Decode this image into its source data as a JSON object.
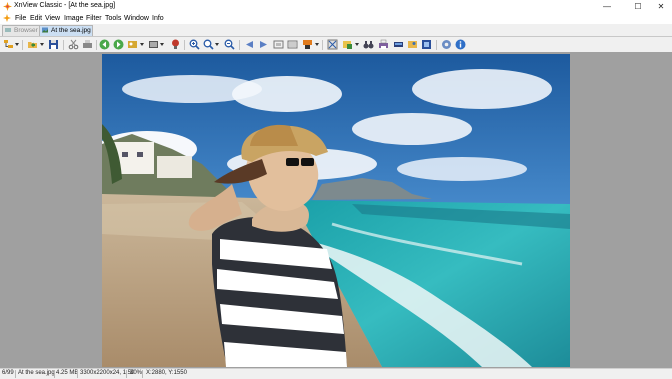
{
  "window": {
    "title": "XnView Classic - [At the sea.jpg]",
    "minimize_glyph": "—",
    "maximize_glyph": "☐",
    "close_glyph": "✕"
  },
  "menu": {
    "items": [
      "File",
      "Edit",
      "View",
      "Image",
      "Filter",
      "Tools",
      "Window",
      "Info"
    ]
  },
  "tabs": [
    {
      "label": "Browser",
      "active": false
    },
    {
      "label": "At the sea.jpg",
      "active": true
    }
  ],
  "toolbar": {
    "icons": [
      "browser-tree-icon",
      "open-folder-icon",
      "save-icon",
      "cut-icon",
      "print-preview-icon",
      "previous-file-icon",
      "next-file-icon",
      "slideshow-icon",
      "capture-icon",
      "properties-icon",
      "zoom-in-icon",
      "zoom-icon",
      "zoom-out-icon",
      "previous-arrow-icon",
      "next-arrow-icon",
      "fit-window-icon",
      "full-screen-icon",
      "color-palette-icon",
      "crop-icon",
      "rotate-icon",
      "binoculars-icon",
      "print-icon",
      "scan-icon",
      "wallpaper-icon",
      "convert-icon",
      "settings-icon",
      "about-icon"
    ]
  },
  "image": {
    "filename": "At the sea.jpg",
    "description": "Woman in striped shirt and straw hat on a pebble beach by the sea"
  },
  "status": {
    "index": "6/99",
    "filename": "At the sea.jpg",
    "filesize": "4.25 MB",
    "dimensions": "3300x2200x24, 1.50",
    "zoom": "30%",
    "coords": "X:2880, Y:1550"
  },
  "colors": {
    "accent": "#ccdff3",
    "viewer_background": "#a0a0a0"
  }
}
